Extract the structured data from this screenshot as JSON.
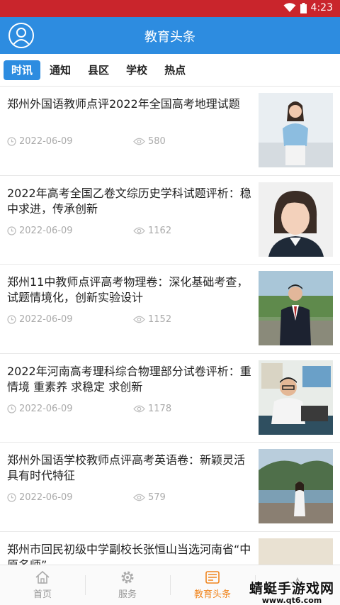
{
  "status_bar": {
    "time": "4:23",
    "icons": [
      "wifi-icon",
      "battery-icon"
    ],
    "color": "#c9252c"
  },
  "app_bar": {
    "title": "教育头条",
    "avatar_icon": "user-avatar-icon",
    "color": "#2d8ce0"
  },
  "tabs": [
    {
      "label": "时讯",
      "active": true
    },
    {
      "label": "通知",
      "active": false
    },
    {
      "label": "县区",
      "active": false
    },
    {
      "label": "学校",
      "active": false
    },
    {
      "label": "热点",
      "active": false
    }
  ],
  "articles": [
    {
      "title": "郑州外国语教师点评2022年全国高考地理试题",
      "date": "2022-06-09",
      "views": "580"
    },
    {
      "title": "2022年高考全国乙卷文综历史学科试题评析：稳中求进，传承创新",
      "date": "2022-06-09",
      "views": "1162"
    },
    {
      "title": "郑州11中教师点评高考物理卷：深化基础考查，试题情境化，创新实验设计",
      "date": "2022-06-09",
      "views": "1152"
    },
    {
      "title": "2022年河南高考理科综合物理部分试卷评析：重情境 重素养 求稳定 求创新",
      "date": "2022-06-09",
      "views": "1178"
    },
    {
      "title": "郑州外国语学校教师点评高考英语卷：新颖灵活具有时代特征",
      "date": "2022-06-09",
      "views": "579"
    },
    {
      "title": "郑州市回民初级中学副校长张恒山当选河南省“中原名师”",
      "date": "",
      "views": ""
    }
  ],
  "bottom_nav": [
    {
      "label": "首页",
      "icon": "home-icon",
      "active": false
    },
    {
      "label": "服务",
      "icon": "gear-icon",
      "active": false
    },
    {
      "label": "教育头条",
      "icon": "news-icon",
      "active": true
    },
    {
      "label": "",
      "icon": "star-icon",
      "active": false
    }
  ],
  "watermark": {
    "text": "蜻蜓手游戏网",
    "url": "www.qt6.com"
  },
  "accent_color": "#f0851e"
}
